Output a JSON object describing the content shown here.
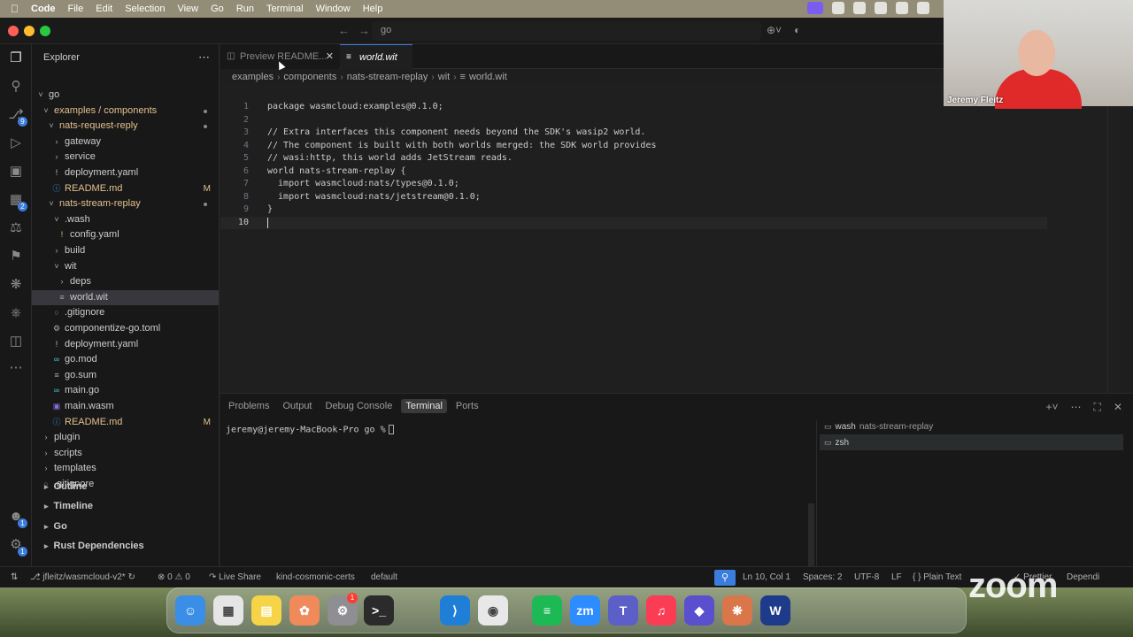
{
  "menubar": {
    "app_name": "Code",
    "items": [
      "File",
      "Edit",
      "Selection",
      "View",
      "Go",
      "Run",
      "Terminal",
      "Window",
      "Help"
    ]
  },
  "titlebar": {
    "search_text": "go"
  },
  "sidebar": {
    "title": "Explorer",
    "tree": [
      {
        "label": "go",
        "icon": "chevron-down"
      },
      {
        "label": "examples / components",
        "icon": "chevron-down",
        "orange": true
      },
      {
        "label": "nats-request-reply",
        "icon": "chevron-down",
        "orange": true
      },
      {
        "label": "gateway",
        "icon": "chevron-right"
      },
      {
        "label": "service",
        "icon": "chevron-right"
      },
      {
        "label": "deployment.yaml",
        "icon": "exclamation"
      },
      {
        "label": "README.md",
        "icon": "info",
        "orange": true,
        "status": "M"
      },
      {
        "label": "nats-stream-replay",
        "icon": "chevron-down",
        "orange": true
      },
      {
        "label": ".wash",
        "icon": "chevron-down"
      },
      {
        "label": "config.yaml",
        "icon": "exclamation"
      },
      {
        "label": "build",
        "icon": "chevron-right"
      },
      {
        "label": "wit",
        "icon": "chevron-down"
      },
      {
        "label": "deps",
        "icon": "chevron-right"
      },
      {
        "label": "world.wit",
        "icon": "lines",
        "selected": true
      },
      {
        "label": ".gitignore",
        "icon": "circle"
      },
      {
        "label": "componentize-go.toml",
        "icon": "gear"
      },
      {
        "label": "deployment.yaml",
        "icon": "exclamation"
      },
      {
        "label": "go.mod",
        "icon": "go"
      },
      {
        "label": "go.sum",
        "icon": "lines"
      },
      {
        "label": "main.go",
        "icon": "go"
      },
      {
        "label": "main.wasm",
        "icon": "wasm"
      },
      {
        "label": "README.md",
        "icon": "info",
        "orange": true,
        "status": "M"
      },
      {
        "label": "plugin",
        "icon": "chevron-right"
      },
      {
        "label": "scripts",
        "icon": "chevron-right"
      },
      {
        "label": "templates",
        "icon": "chevron-right"
      },
      {
        "label": ".gitignore",
        "icon": "circle"
      }
    ],
    "sections": [
      "Outline",
      "Timeline",
      "Go",
      "Rust Dependencies"
    ]
  },
  "tabs": [
    {
      "label": "Preview README.md",
      "display": "Preview README..."
    },
    {
      "label": "world.wit"
    }
  ],
  "breadcrumb": [
    "examples",
    "components",
    "nats-stream-replay",
    "wit",
    "world.wit"
  ],
  "code": [
    {
      "n": "1",
      "text": "package wasmcloud:examples@0.1.0;"
    },
    {
      "n": "2",
      "text": ""
    },
    {
      "n": "3",
      "text": "// Extra interfaces this component needs beyond the SDK's wasip2 world."
    },
    {
      "n": "4",
      "text": "// The component is built with both worlds merged: the SDK world provides"
    },
    {
      "n": "5",
      "text": "// wasi:http, this world adds JetStream reads."
    },
    {
      "n": "6",
      "text": "world nats-stream-replay {"
    },
    {
      "n": "7",
      "text": "  import wasmcloud:nats/types@0.1.0;"
    },
    {
      "n": "8",
      "text": "  import wasmcloud:nats/jetstream@0.1.0;"
    },
    {
      "n": "9",
      "text": "}"
    },
    {
      "n": "10",
      "text": ""
    }
  ],
  "panel": {
    "tabs": [
      "Problems",
      "Output",
      "Debug Console",
      "Terminal",
      "Ports"
    ],
    "active_tab": "Terminal",
    "prompt": "jeremy@jeremy-MacBook-Pro go %",
    "terminals": [
      {
        "name": "wash",
        "sub": "nats-stream-replay"
      },
      {
        "name": "zsh",
        "sub": ""
      }
    ]
  },
  "statusbar": {
    "branch": "jfleitz/wasmcloud-v2*",
    "errors": "0",
    "warnings": "0",
    "live_share": "Live Share",
    "context": "kind-cosmonic-certs",
    "namespace": "default",
    "position": "Ln 10, Col 1",
    "spaces": "Spaces: 2",
    "encoding": "UTF-8",
    "eol": "LF",
    "language": "Plain Text",
    "prettier": "Prettier",
    "deps": "Dependi"
  },
  "video": {
    "participant": "Jeremy Fleitz"
  },
  "overlay": {
    "zoom_logo": "zoom"
  },
  "dock": {
    "apps": [
      "Finder",
      "Launchpad",
      "Notes",
      "Photos",
      "System Settings",
      "Terminal",
      "Visual Studio Code",
      "Chrome",
      "Spotify",
      "Zoom",
      "Teams",
      "Music",
      "Affinity",
      "Claude",
      "Webex"
    ],
    "badge": "1"
  },
  "colors": {
    "accent": "#3b7ddd",
    "modified": "#e2c08d",
    "editor_bg": "#1f1f1f"
  }
}
